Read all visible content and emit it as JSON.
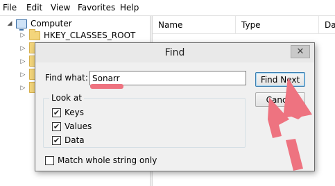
{
  "menubar": {
    "items": [
      "File",
      "Edit",
      "View",
      "Favorites",
      "Help"
    ]
  },
  "tree": {
    "root": "Computer",
    "first_child": "HKEY_CLASSES_ROOT"
  },
  "list": {
    "columns": [
      "Name",
      "Type",
      "Dat"
    ]
  },
  "dialog": {
    "title": "Find",
    "close_glyph": "✕",
    "find_what_label": "Find what:",
    "find_what_value": "Sonarr",
    "find_next_label": "Find Next",
    "cancel_label": "Cancel",
    "look_at_label": "Look at",
    "keys_label": "Keys",
    "values_label": "Values",
    "data_label": "Data",
    "keys_checked": true,
    "values_checked": true,
    "data_checked": true,
    "match_whole_label": "Match whole string only",
    "match_whole_checked": false
  },
  "colors": {
    "annotation": "#ee7380",
    "folder": "#f3d57b"
  }
}
